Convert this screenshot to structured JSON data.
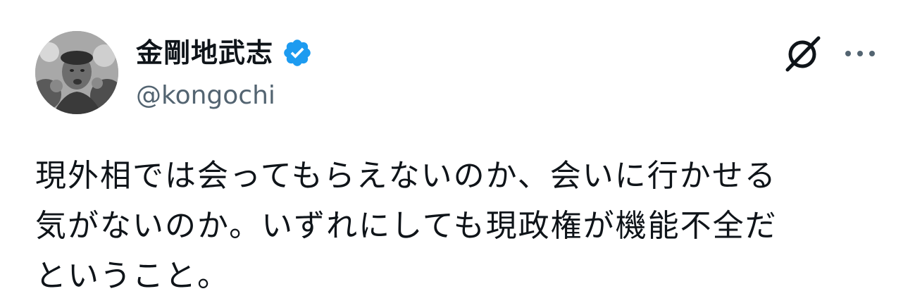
{
  "author": {
    "display_name": "金剛地武志",
    "handle": "@kongochi",
    "verified": true
  },
  "tweet": {
    "text": "現外相では会ってもらえないのか、会いに行かせる\n気がないのか。いずれにしても現政権が機能不全だ\nということ。"
  },
  "icons": {
    "avatar": "avatar-photo",
    "verified": "verified-badge-icon",
    "grok": "grok-icon",
    "more": "more-options-icon"
  },
  "colors": {
    "verified_badge": "#1d9bf0",
    "text_primary": "#0f1419",
    "text_secondary": "#536471"
  }
}
